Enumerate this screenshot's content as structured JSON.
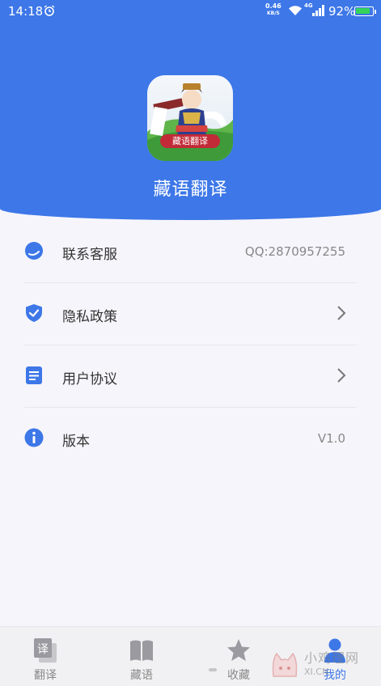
{
  "status_bar": {
    "time": "14:18",
    "net_speed_value": "0.46",
    "net_speed_unit": "KB/S",
    "network_type": "4G",
    "battery_text": "92%",
    "battery_level": 0.92
  },
  "header": {
    "app_icon_banner": "藏语翻译",
    "app_name": "藏语翻译",
    "background_color": "#3d77e8"
  },
  "menu": {
    "items": [
      {
        "icon": "customer-service-icon",
        "label": "联系客服",
        "value": "QQ:2870957255"
      },
      {
        "icon": "shield-check-icon",
        "label": "隐私政策",
        "value": ""
      },
      {
        "icon": "document-icon",
        "label": "用户协议",
        "value": ""
      },
      {
        "icon": "info-icon",
        "label": "版本",
        "value": "V1.0"
      }
    ]
  },
  "tabbar": {
    "tabs": [
      {
        "icon": "translate-icon",
        "label": "翻译",
        "active": false
      },
      {
        "icon": "book-icon",
        "label": "藏语",
        "active": false
      },
      {
        "icon": "star-icon",
        "label": "收藏",
        "active": false
      },
      {
        "icon": "person-icon",
        "label": "我的",
        "active": true
      }
    ]
  },
  "watermark": {
    "text": "小鸡理网",
    "sub": "XI.CN"
  },
  "colors": {
    "accent": "#3d77e8",
    "inactive": "#888888"
  }
}
